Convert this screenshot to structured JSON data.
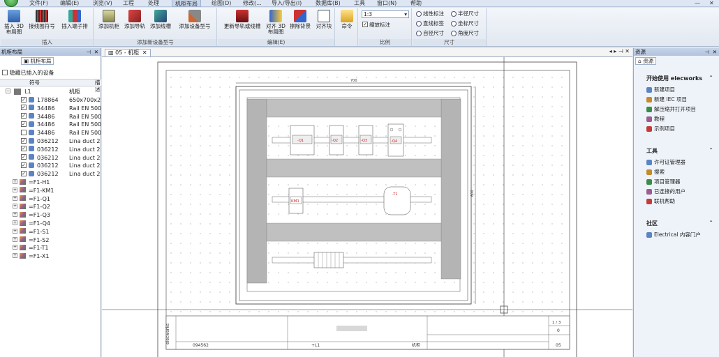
{
  "menu": {
    "items": [
      "文件(F)",
      "编辑(E)",
      "浏览(V)",
      "工程",
      "处理",
      "机柜布局",
      "绘图(D)",
      "修改(...",
      "导入/导出(I)",
      "数据库(B)",
      "工具",
      "窗口(N)",
      "帮助"
    ],
    "active_index": 5,
    "window_buttons": [
      "—",
      "✕"
    ]
  },
  "ribbon": {
    "groups": [
      {
        "label": "插入",
        "buttons": [
          "插入 3D 布局图",
          "接线图符号",
          "插入端子排"
        ]
      },
      {
        "label": "添加新设备型号",
        "buttons": [
          "添加机柜",
          "添加导轨",
          "添加线槽",
          "添加设备型号"
        ]
      },
      {
        "label": "编辑(E)",
        "buttons": [
          "更新导轨或线槽",
          "对齐 3D 布局图",
          "擦除背景",
          "对齐块"
        ]
      },
      {
        "label": "",
        "buttons": [
          "命令"
        ]
      },
      {
        "label": "比例",
        "scale_value": "1:3",
        "scale_checkbox": "缩放标注"
      },
      {
        "label": "尺寸",
        "rows": [
          [
            "线性标注",
            "半径尺寸"
          ],
          [
            "直线标签",
            "坐标尺寸"
          ],
          [
            "自径尺寸",
            "角度尺寸"
          ]
        ]
      }
    ]
  },
  "left_panel": {
    "title": "机柜布局",
    "tab": "机柜布局",
    "hide_checkbox": "隐藏已插入的设备",
    "columns": [
      "符号",
      "描述"
    ],
    "root": {
      "name": "L1",
      "desc": "机柜"
    },
    "items": [
      {
        "code": "178864",
        "desc": "650x700x2",
        "checked": true
      },
      {
        "code": "34486",
        "desc": "Rail EN 500",
        "checked": true
      },
      {
        "code": "34486",
        "desc": "Rail EN 500",
        "checked": true
      },
      {
        "code": "34486",
        "desc": "Rail EN 500",
        "checked": true
      },
      {
        "code": "34486",
        "desc": "Rail EN 500",
        "checked": false
      },
      {
        "code": "036212",
        "desc": "Lina duct 2",
        "checked": true
      },
      {
        "code": "036212",
        "desc": "Lina duct 2",
        "checked": true
      },
      {
        "code": "036212",
        "desc": "Lina duct 2",
        "checked": true
      },
      {
        "code": "036212",
        "desc": "Lina duct 2",
        "checked": true
      },
      {
        "code": "036212",
        "desc": "Lina duct 2",
        "checked": true
      }
    ],
    "components": [
      "=F1-H1",
      "=F1-KM1",
      "=F1-Q1",
      "=F1-Q2",
      "=F1-Q3",
      "=F1-Q4",
      "=F1-S1",
      "=F1-S2",
      "=F1-T1",
      "=F1-X1"
    ]
  },
  "document": {
    "tab_label": "05 - 机柜",
    "dimension_top": "700",
    "dimension_right": "600",
    "device_labels": [
      "-Q1",
      "-Q2",
      "-Q3",
      "-Q4",
      "KM1",
      "-T1"
    ],
    "title_block": {
      "brand": "elecworks",
      "code": "094562",
      "location": "+L1",
      "type": "机柜",
      "page_of": "1 / 3",
      "revision": "0",
      "sheet": "05"
    }
  },
  "right_panel": {
    "title": "资源",
    "tab": "资源",
    "sections": [
      {
        "heading": "开始使用 elecworks",
        "items": [
          "新建项目",
          "新建 IEC 项目",
          "解压缩并打开项目",
          "教程",
          "示例项目"
        ]
      },
      {
        "heading": "工具",
        "items": [
          "许可证管理器",
          "搜索",
          "项目管理器",
          "已连接的用户",
          "联机帮助"
        ]
      },
      {
        "heading": "社区",
        "items": [
          "Electrical 内容门户"
        ]
      }
    ]
  },
  "colors": {
    "accent": "#3a6fb0",
    "rail": "#c8c8c8",
    "duct": "#b4b4b4",
    "label_red": "#cc2222"
  }
}
